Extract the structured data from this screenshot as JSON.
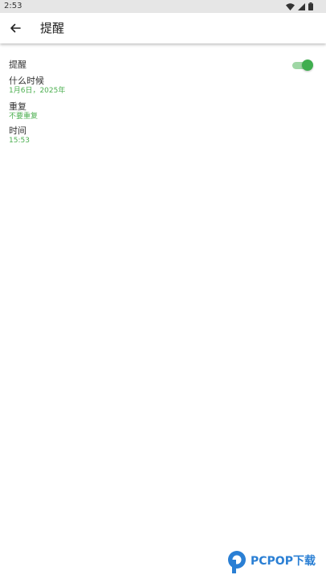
{
  "status_bar": {
    "time": "2:53",
    "icons": [
      "wifi-icon",
      "signal-icon",
      "battery-icon"
    ]
  },
  "app_bar": {
    "back_icon": "arrow-back-icon",
    "title": "提醒"
  },
  "settings": {
    "reminder": {
      "label": "提醒",
      "enabled": true
    },
    "when": {
      "label": "什么时候",
      "value": "1月6日，2025年"
    },
    "repeat": {
      "label": "重复",
      "value": "不要重复"
    },
    "time": {
      "label": "时间",
      "value": "15:53"
    }
  },
  "watermark": {
    "text": "PCPOP下载"
  },
  "colors": {
    "accent": "#4caf50",
    "toggle_thumb": "#3fae4f",
    "toggle_track": "#9fd7a5",
    "status_bar_bg": "#e6e6e6",
    "watermark": "#2a7fd4"
  }
}
